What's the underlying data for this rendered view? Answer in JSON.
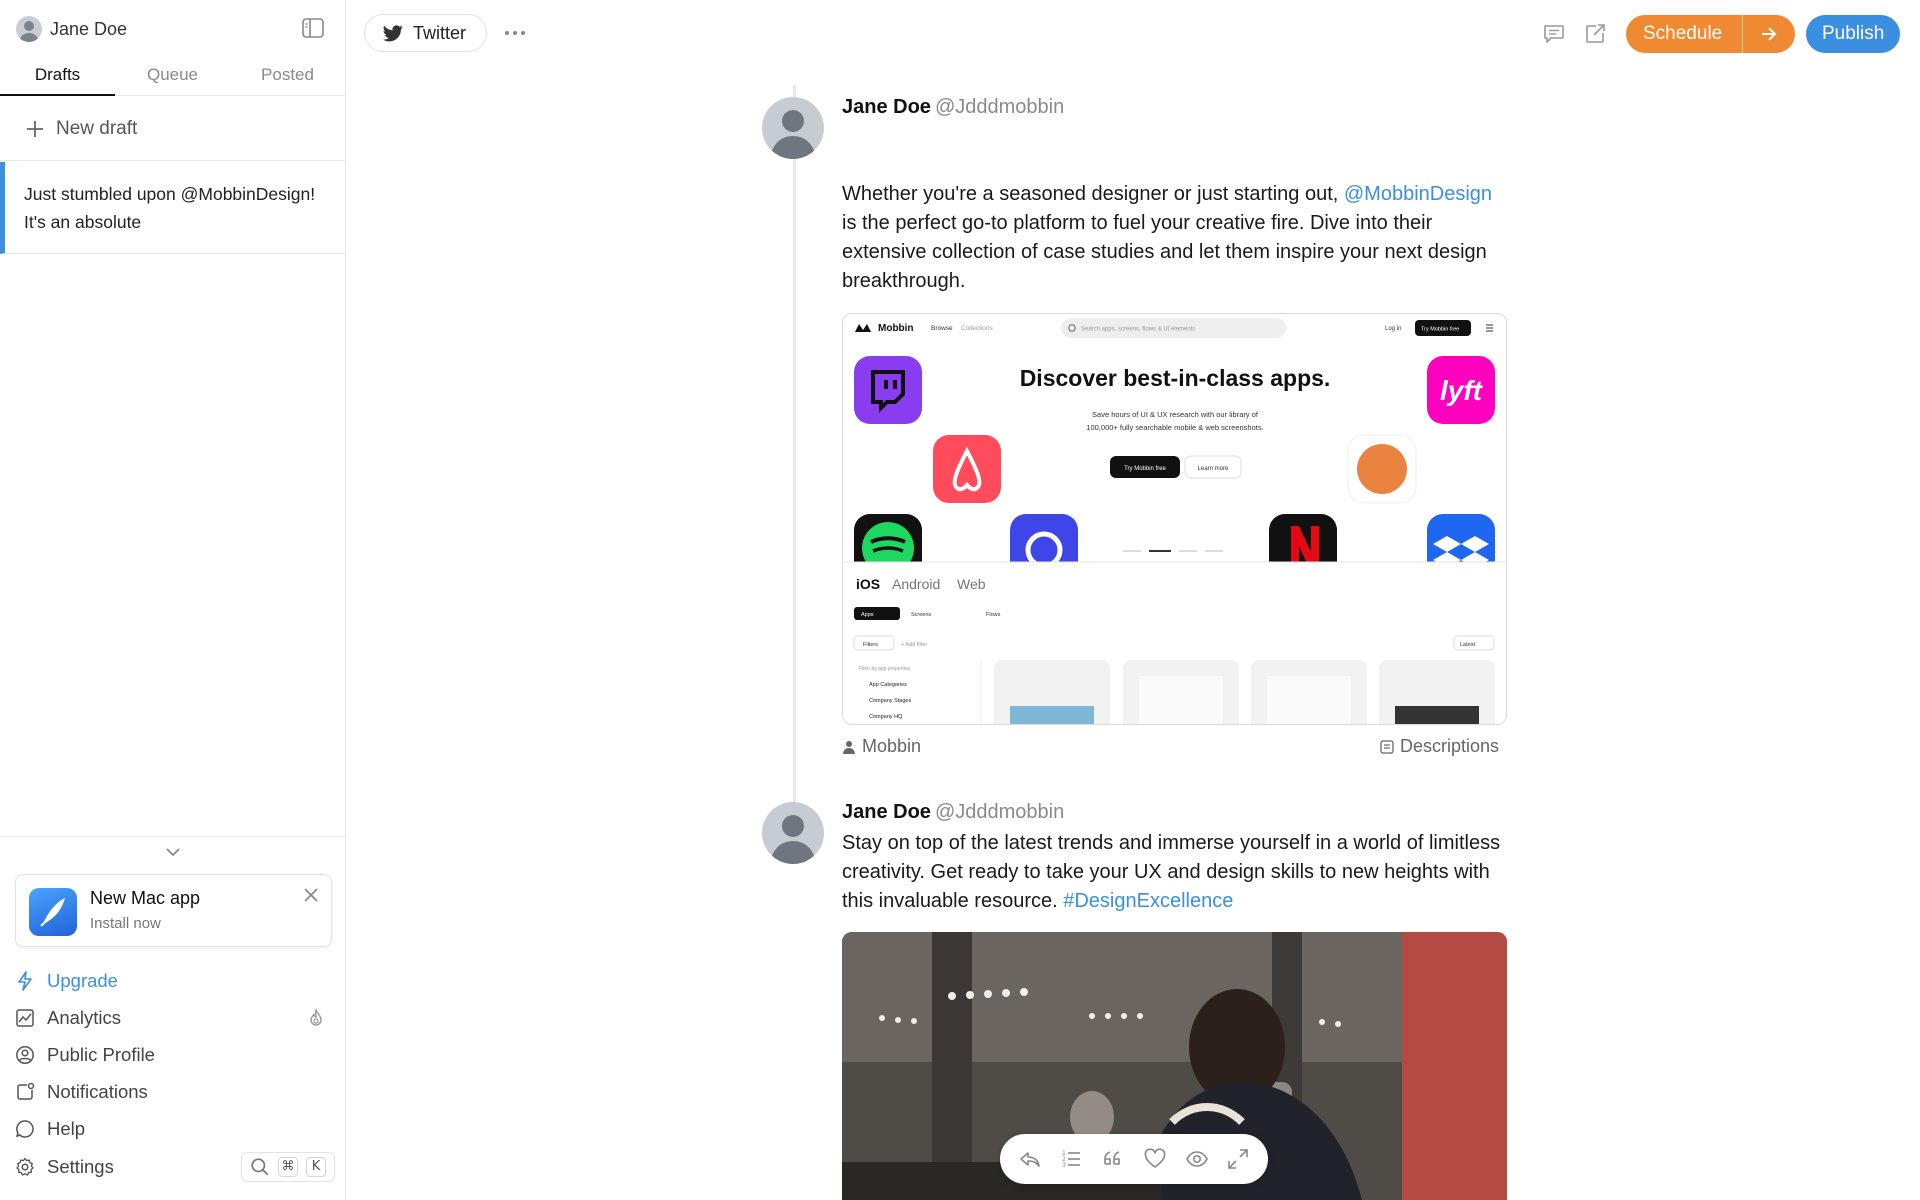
{
  "sidebar": {
    "account_name": "Jane Doe",
    "tabs": [
      {
        "label": "Drafts",
        "active": true
      },
      {
        "label": "Queue",
        "active": false
      },
      {
        "label": "Posted",
        "active": false
      }
    ],
    "new_draft_label": "New draft",
    "drafts": [
      {
        "preview": "Just stumbled upon @MobbinDesign! It's an absolute"
      }
    ],
    "promo": {
      "title": "New Mac app",
      "subtitle": "Install now"
    },
    "menu": [
      {
        "label": "Upgrade",
        "icon": "bolt-icon"
      },
      {
        "label": "Analytics",
        "icon": "chart-icon"
      },
      {
        "label": "Public Profile",
        "icon": "user-circle-icon"
      },
      {
        "label": "Notifications",
        "icon": "bell-icon"
      },
      {
        "label": "Help",
        "icon": "chat-bubble-icon"
      },
      {
        "label": "Settings",
        "icon": "gear-icon"
      }
    ],
    "shortcut_keys": [
      "⌘",
      "K"
    ]
  },
  "topbar": {
    "platform_label": "Twitter",
    "schedule_label": "Schedule",
    "publish_label": "Publish"
  },
  "thread": [
    {
      "author_name": "Jane Doe",
      "handle": "@Jdddmobbin",
      "text_before": "Whether you're a seasoned designer or just starting out, ",
      "mention": "@MobbinDesign",
      "text_after": " is the perfect go-to platform to fuel your creative fire. Dive into their extensive collection of case studies and let them inspire your next design breakthrough.",
      "media": {
        "brand": "Mobbin",
        "nav_browse": "Browse",
        "nav_collections": "Collections",
        "search_placeholder": "Search apps, screens, flows & UI elements",
        "login": "Log in",
        "cta": "Try Mobbin free",
        "headline": "Discover best-in-class apps.",
        "sub1": "Save hours of UI & UX research with our library of",
        "sub2": "100,000+ fully searchable mobile & web screenshots.",
        "btn_primary": "Try Mobbin free",
        "btn_secondary": "Learn more",
        "platforms": [
          "iOS",
          "Android",
          "Web"
        ],
        "pills": [
          "Apps",
          "Screens",
          "Flows"
        ],
        "filters_label": "Filters",
        "add_filter": "+ Add filter",
        "latest_label": "Latest",
        "filter_heading": "Filter by app properties",
        "filter_items": [
          "App Categories",
          "Company Stages",
          "Company HQ"
        ]
      },
      "footer_left": "Mobbin",
      "footer_right": "Descriptions"
    },
    {
      "author_name": "Jane Doe",
      "handle": "@Jdddmobbin",
      "text_before": "Stay on top of the latest trends and immerse yourself in a world of limitless creativity. Get ready to take your UX and design skills to new heights with this invaluable resource. ",
      "hashtag": "#DesignExcellence"
    }
  ],
  "colors": {
    "accent_blue": "#3b8fe0",
    "schedule_orange": "#ef8a33"
  }
}
